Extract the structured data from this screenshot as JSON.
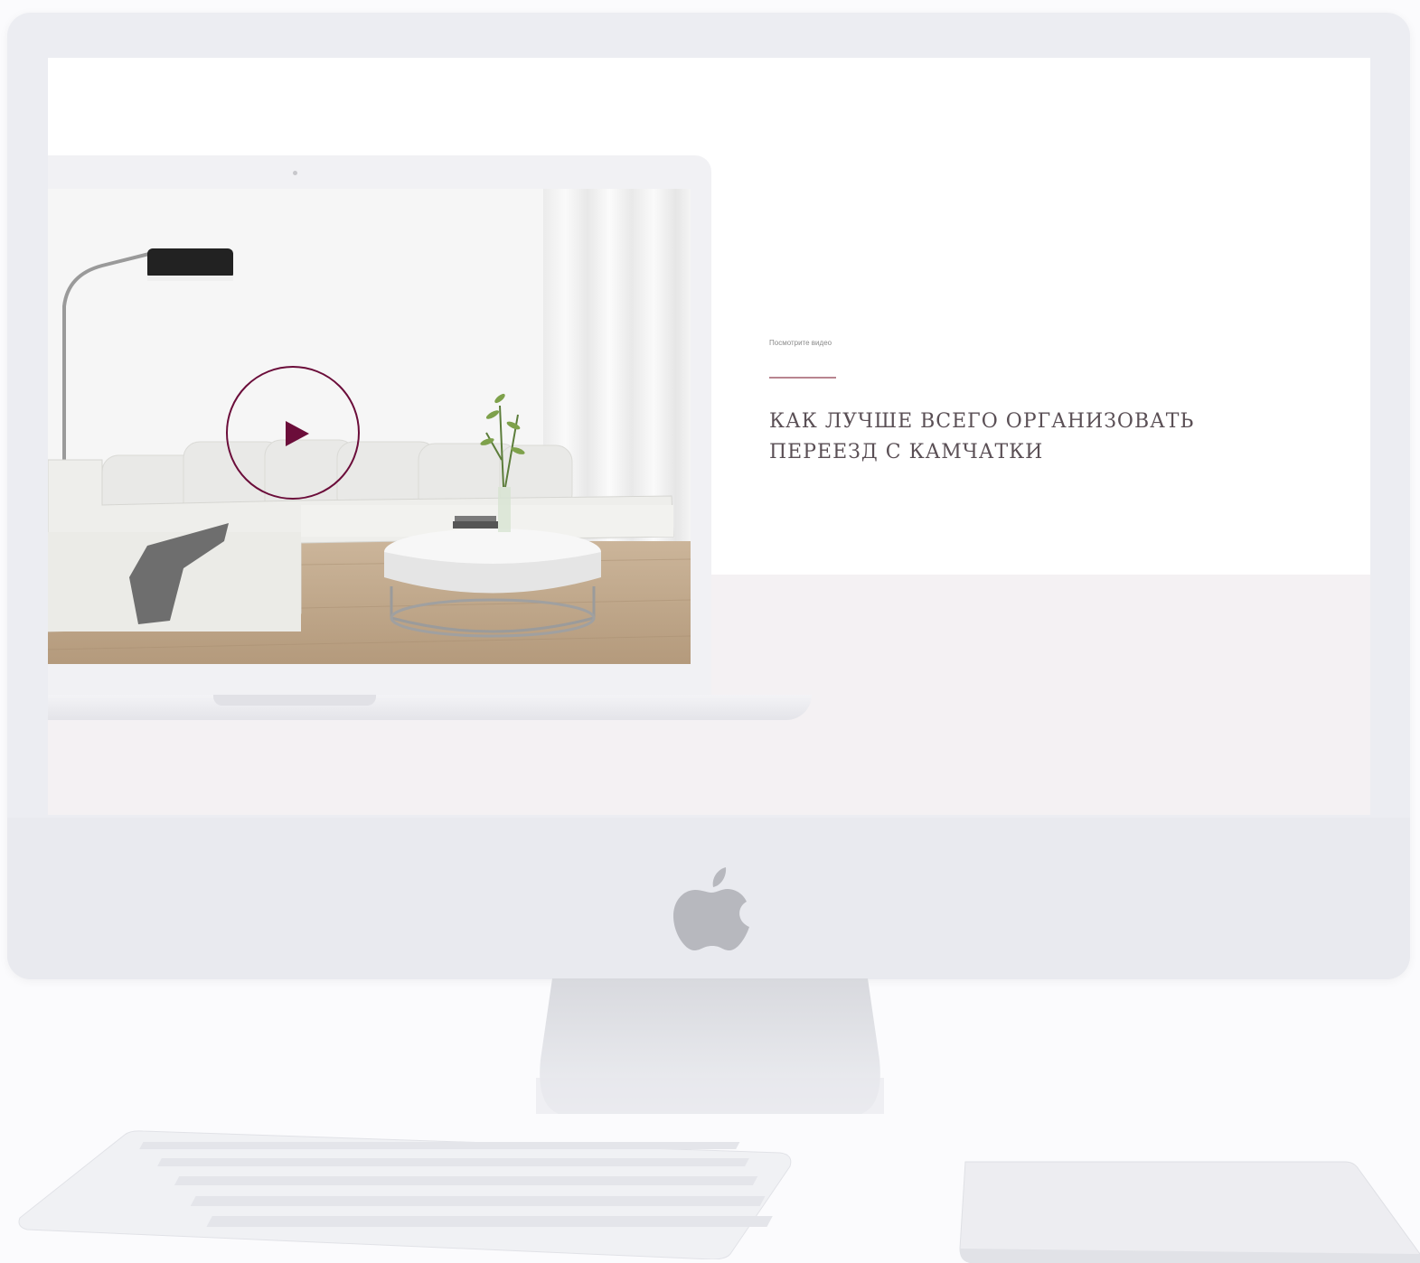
{
  "video_section": {
    "eyebrow": "Посмотрите видео",
    "headline": "КАК ЛУЧШЕ ВСЕГО ОРГАНИЗОВАТЬ\nПЕРЕЕЗД С КАМЧАТКИ"
  },
  "colors": {
    "accent": "#6b0d3a",
    "accent_line": "#b8848f",
    "headline_text": "#5a4f55",
    "band_background": "#f4f1f3"
  },
  "icons": {
    "play": "play-icon",
    "brand": "apple-logo-icon"
  }
}
